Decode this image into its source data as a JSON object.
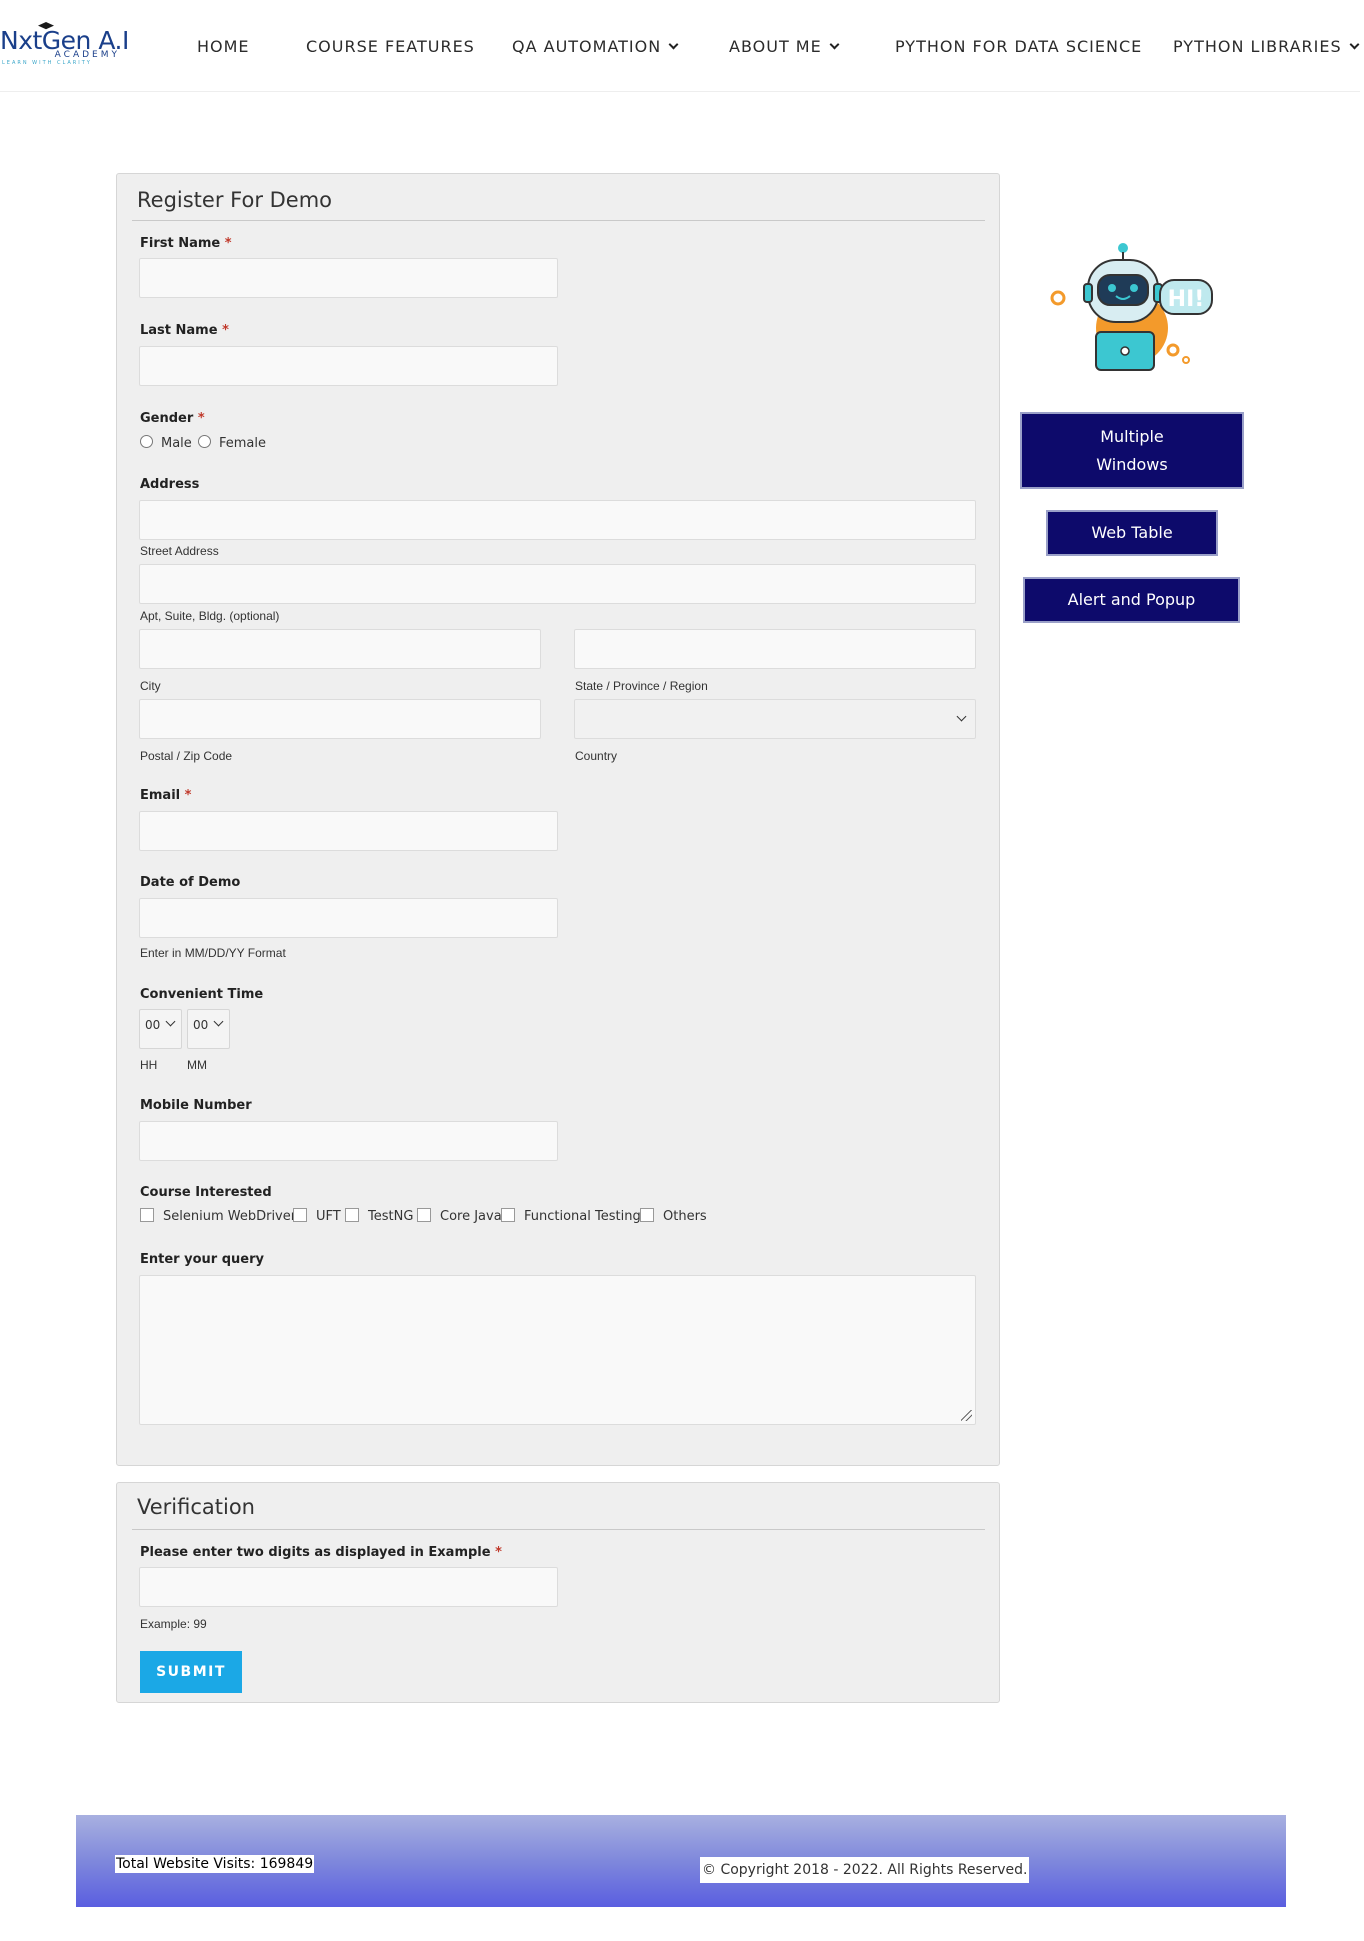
{
  "header": {
    "logo": {
      "main": "NxtGen A.I",
      "sub": "ACADEMY",
      "tagline": "LEARN WITH CLARITY"
    },
    "nav": [
      {
        "label": "HOME",
        "has_dropdown": false
      },
      {
        "label": "COURSE FEATURES",
        "has_dropdown": false
      },
      {
        "label": "QA AUTOMATION",
        "has_dropdown": true
      },
      {
        "label": "ABOUT ME",
        "has_dropdown": true
      },
      {
        "label": "PYTHON FOR DATA SCIENCE",
        "has_dropdown": false
      },
      {
        "label": "PYTHON LIBRARIES",
        "has_dropdown": true
      }
    ]
  },
  "form": {
    "title": "Register For Demo",
    "required_mark": "*",
    "first_name": {
      "label": "First Name",
      "value": ""
    },
    "last_name": {
      "label": "Last Name",
      "value": ""
    },
    "gender": {
      "label": "Gender",
      "options": [
        "Male",
        "Female"
      ],
      "selected": null
    },
    "address": {
      "label": "Address",
      "street_caption": "Street Address",
      "apt_caption": "Apt, Suite, Bldg. (optional)",
      "city_caption": "City",
      "state_caption": "State / Province / Region",
      "zip_caption": "Postal / Zip Code",
      "country_caption": "Country",
      "country_value": ""
    },
    "email": {
      "label": "Email",
      "value": ""
    },
    "date_of_demo": {
      "label": "Date of Demo",
      "hint": "Enter in MM/DD/YY Format",
      "value": ""
    },
    "convenient_time": {
      "label": "Convenient Time",
      "hh_value": "00",
      "mm_value": "00",
      "hh_caption": "HH",
      "mm_caption": "MM"
    },
    "mobile": {
      "label": "Mobile Number",
      "value": ""
    },
    "courses": {
      "label": "Course Interested",
      "options": [
        "Selenium WebDriver",
        "UFT",
        "TestNG",
        "Core Java",
        "Functional Testing",
        "Others"
      ]
    },
    "query": {
      "label": "Enter your query",
      "value": ""
    }
  },
  "verification": {
    "title": "Verification",
    "label": "Please enter two digits as displayed in Example",
    "hint": "Example: 99",
    "value": "",
    "submit_label": "SUBMIT"
  },
  "sidebar": {
    "bubble_text": "HI!",
    "buttons": [
      "Multiple Windows",
      "Web Table",
      "Alert and Popup"
    ]
  },
  "footer": {
    "visits": "Total Website Visits: 169849",
    "copyright": "© Copyright 2018 - 2022. All Rights Reserved."
  },
  "colors": {
    "accent_button": "#0d0a6b",
    "submit": "#1ba8e6",
    "panel_bg": "#efefef",
    "footer_gradient_end": "#5a5ee0"
  }
}
